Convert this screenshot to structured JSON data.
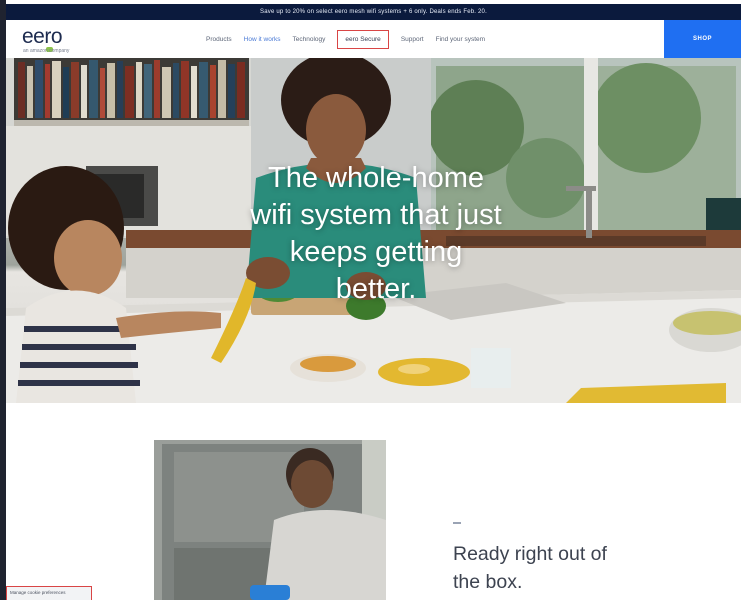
{
  "promo_bar": {
    "text": "Save up to 20% on select eero mesh wifi systems + 6 only. Deals ends Feb. 20."
  },
  "header": {
    "logo_text": "eero",
    "logo_subtext": "an amazon company",
    "nav": [
      {
        "label": "Products"
      },
      {
        "label": "How it works"
      },
      {
        "label": "Technology"
      },
      {
        "label": "eero Secure"
      },
      {
        "label": "Support"
      },
      {
        "label": "Find your system"
      }
    ],
    "shop_label": "SHOP"
  },
  "hero": {
    "headline_lines": [
      "The whole-home",
      "wifi system that just",
      "keeps getting",
      "better."
    ]
  },
  "feature": {
    "title_lines": [
      "Ready right out of",
      "the box."
    ]
  },
  "cookie_tag": {
    "text": "Manage cookie preferences"
  },
  "colors": {
    "promo_bg": "#0b1a3d",
    "shop_bg": "#1f6ff2",
    "active_nav": "#4b7bd6",
    "highlight_border": "#d94545"
  }
}
